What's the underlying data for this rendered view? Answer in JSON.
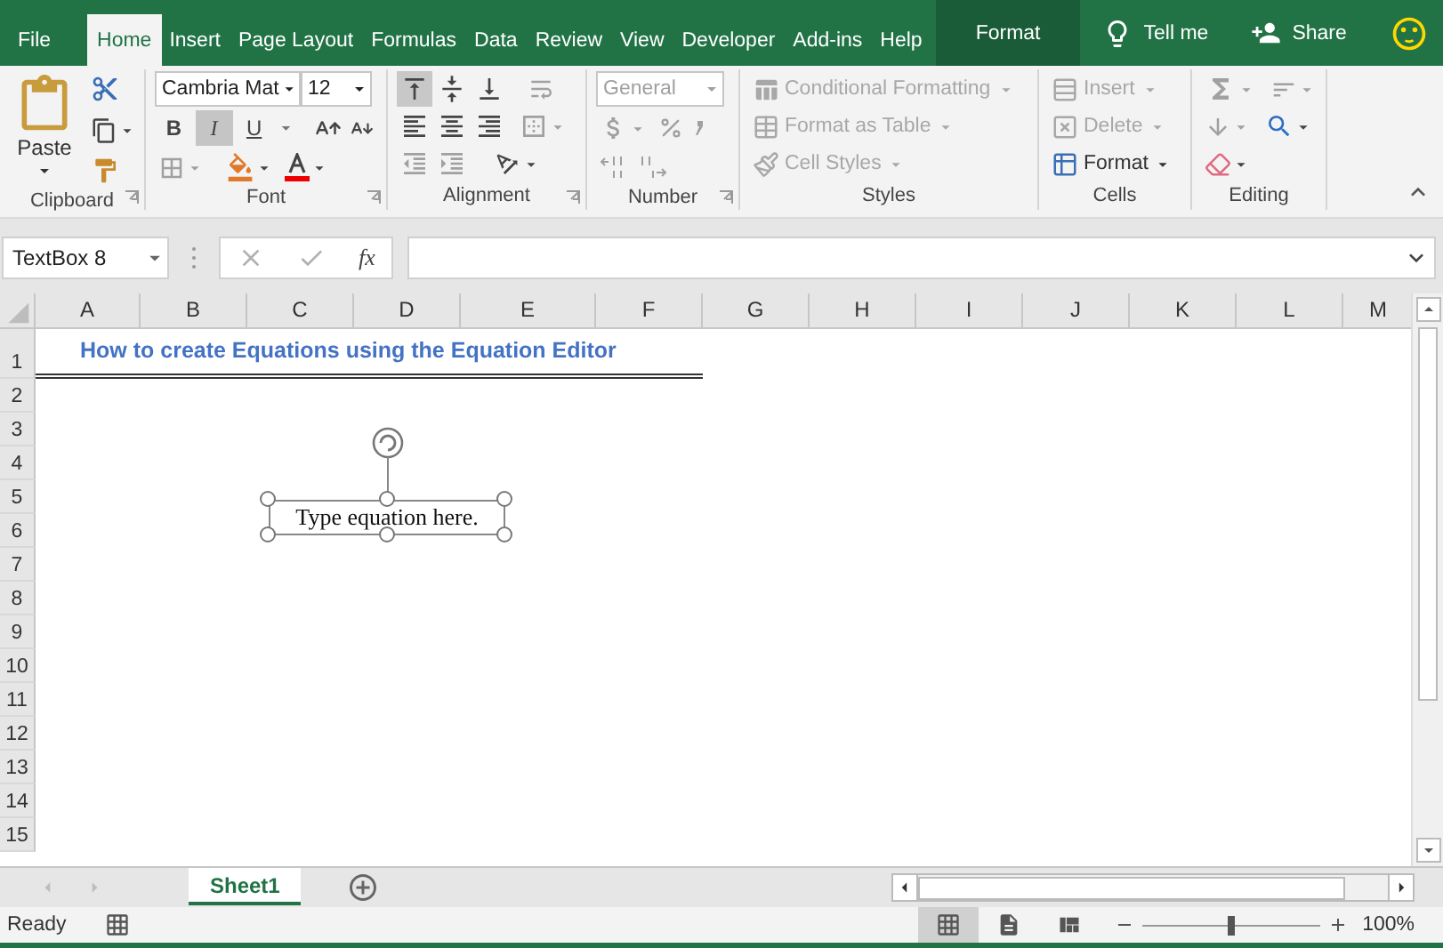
{
  "tabs": [
    {
      "label": "File",
      "selected": false,
      "kind": "normal"
    },
    {
      "label": "Home",
      "selected": true,
      "kind": "normal"
    },
    {
      "label": "Insert",
      "selected": false,
      "kind": "normal"
    },
    {
      "label": "Page Layout",
      "selected": false,
      "kind": "normal"
    },
    {
      "label": "Formulas",
      "selected": false,
      "kind": "normal"
    },
    {
      "label": "Data",
      "selected": false,
      "kind": "normal"
    },
    {
      "label": "Review",
      "selected": false,
      "kind": "normal"
    },
    {
      "label": "View",
      "selected": false,
      "kind": "normal"
    },
    {
      "label": "Developer",
      "selected": false,
      "kind": "normal"
    },
    {
      "label": "Add-ins",
      "selected": false,
      "kind": "normal"
    },
    {
      "label": "Help",
      "selected": false,
      "kind": "normal"
    },
    {
      "label": "Format",
      "selected": false,
      "kind": "contextual"
    }
  ],
  "tell_me": "Tell me",
  "share": "Share",
  "clipboard": {
    "title": "Clipboard",
    "paste": "Paste"
  },
  "font": {
    "title": "Font",
    "name": "Cambria Mat",
    "size": "12",
    "styles": [
      {
        "label": "B",
        "kind": "bold",
        "selected": false
      },
      {
        "label": "I",
        "kind": "italic",
        "selected": true
      },
      {
        "label": "U",
        "kind": "underline",
        "selected": false
      }
    ]
  },
  "alignment": {
    "title": "Alignment",
    "vertical": [
      {
        "kind": "top",
        "selected": true
      },
      {
        "kind": "middle",
        "selected": false
      },
      {
        "kind": "bottom",
        "selected": false
      }
    ]
  },
  "number": {
    "title": "Number",
    "format": "General",
    "disabled": true
  },
  "styles": {
    "title": "Styles",
    "commands": [
      {
        "label": "Conditional Formatting",
        "kind": "conditional",
        "disabled": true
      },
      {
        "label": "Format as Table",
        "kind": "table",
        "disabled": true
      },
      {
        "label": "Cell Styles",
        "kind": "styles",
        "disabled": true
      }
    ]
  },
  "cells": {
    "title": "Cells",
    "commands": [
      {
        "label": "Insert",
        "kind": "insert",
        "disabled": true
      },
      {
        "label": "Delete",
        "kind": "delete",
        "disabled": true
      },
      {
        "label": "Format",
        "kind": "format",
        "disabled": false
      }
    ]
  },
  "editing": {
    "title": "Editing"
  },
  "formula_bar": {
    "name_box": "TextBox 8",
    "fx": "fx"
  },
  "sheet": {
    "columns": [
      "A",
      "B",
      "C",
      "D",
      "E",
      "F",
      "G",
      "H",
      "I",
      "J",
      "K",
      "L",
      "M"
    ],
    "rows": [
      "1",
      "2",
      "3",
      "4",
      "5",
      "6",
      "7",
      "8",
      "9",
      "10",
      "11",
      "12",
      "13",
      "14",
      "15"
    ],
    "title": "How to create Equations using the Equation Editor"
  },
  "equation_box": {
    "text": "Type equation here."
  },
  "sheet_tabs": [
    {
      "label": "Sheet1",
      "selected": true
    }
  ],
  "status_bar": {
    "status": "Ready",
    "views": [
      {
        "kind": "normal",
        "selected": true
      },
      {
        "kind": "page_layout",
        "selected": false
      },
      {
        "kind": "page_break",
        "selected": false
      }
    ],
    "zoom": {
      "level": 0.5,
      "reading": "100%"
    }
  }
}
